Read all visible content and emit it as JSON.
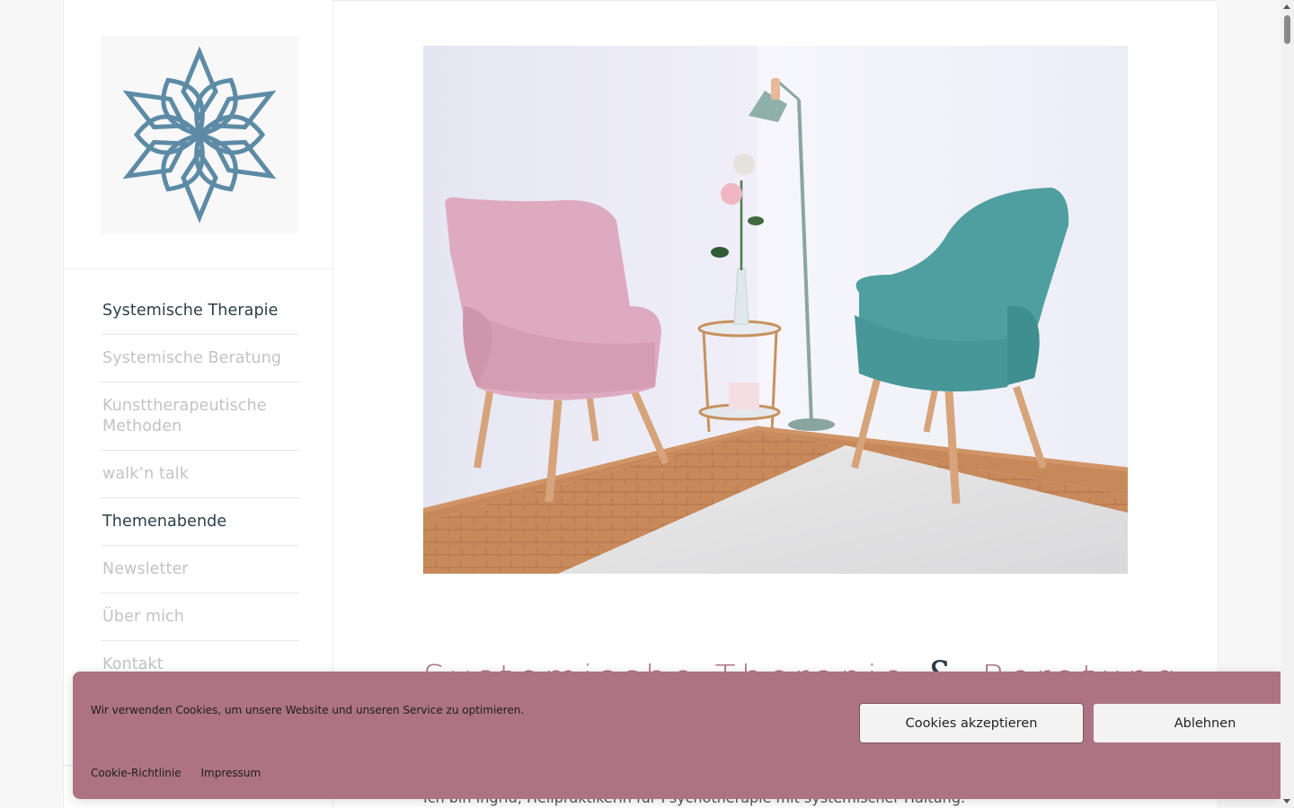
{
  "sidebar": {
    "logo_name": "lotus-logo",
    "items": [
      {
        "label": "Systemische Therapie",
        "active": true
      },
      {
        "label": "Systemische Beratung",
        "active": false
      },
      {
        "label": "Kunsttherapeutische Methoden",
        "active": false
      },
      {
        "label": "walk’n talk",
        "active": false
      },
      {
        "label": "Themenabende",
        "active": true
      },
      {
        "label": "Newsletter",
        "active": false
      },
      {
        "label": "Über mich",
        "active": false
      },
      {
        "label": "Kontakt",
        "active": false
      }
    ]
  },
  "main": {
    "heading_part1": "Systemische Therapie",
    "heading_amp": "&",
    "heading_part2": "Beratung",
    "intro": "Ich bin Ingrid, Heilpraktikerin für Psychotherapie mit systemischer Haltung."
  },
  "cookie_banner": {
    "message": "Wir verwenden Cookies, um unsere Website und unseren Service zu optimieren.",
    "accept_label": "Cookies akzeptieren",
    "decline_label": "Ablehnen",
    "links": [
      "Cookie-Richtlinie",
      "Impressum"
    ]
  },
  "colors": {
    "brand_rose": "#ad7383",
    "brand_blue": "#5b8aa6",
    "text_dark": "#2c3e4a",
    "nav_muted": "#c3c3c3"
  }
}
